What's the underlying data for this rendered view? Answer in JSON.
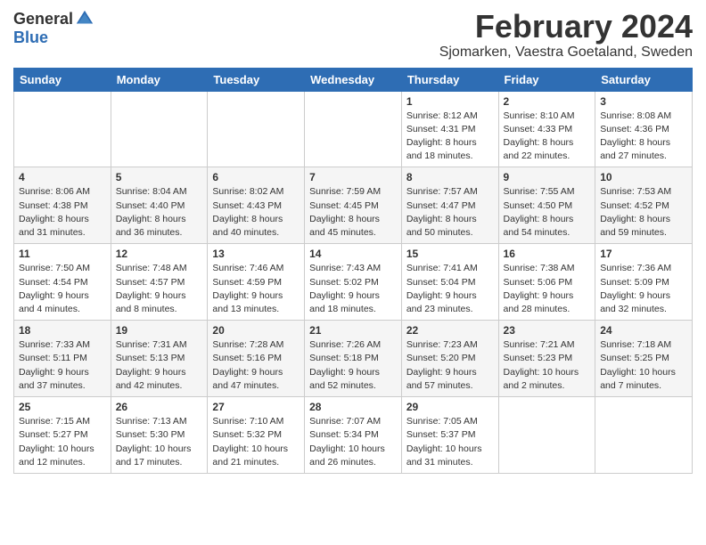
{
  "header": {
    "logo_general": "General",
    "logo_blue": "Blue",
    "month_title": "February 2024",
    "location": "Sjomarken, Vaestra Goetaland, Sweden"
  },
  "days_of_week": [
    "Sunday",
    "Monday",
    "Tuesday",
    "Wednesday",
    "Thursday",
    "Friday",
    "Saturday"
  ],
  "weeks": [
    [
      {
        "day": "",
        "info": ""
      },
      {
        "day": "",
        "info": ""
      },
      {
        "day": "",
        "info": ""
      },
      {
        "day": "",
        "info": ""
      },
      {
        "day": "1",
        "info": "Sunrise: 8:12 AM\nSunset: 4:31 PM\nDaylight: 8 hours\nand 18 minutes."
      },
      {
        "day": "2",
        "info": "Sunrise: 8:10 AM\nSunset: 4:33 PM\nDaylight: 8 hours\nand 22 minutes."
      },
      {
        "day": "3",
        "info": "Sunrise: 8:08 AM\nSunset: 4:36 PM\nDaylight: 8 hours\nand 27 minutes."
      }
    ],
    [
      {
        "day": "4",
        "info": "Sunrise: 8:06 AM\nSunset: 4:38 PM\nDaylight: 8 hours\nand 31 minutes."
      },
      {
        "day": "5",
        "info": "Sunrise: 8:04 AM\nSunset: 4:40 PM\nDaylight: 8 hours\nand 36 minutes."
      },
      {
        "day": "6",
        "info": "Sunrise: 8:02 AM\nSunset: 4:43 PM\nDaylight: 8 hours\nand 40 minutes."
      },
      {
        "day": "7",
        "info": "Sunrise: 7:59 AM\nSunset: 4:45 PM\nDaylight: 8 hours\nand 45 minutes."
      },
      {
        "day": "8",
        "info": "Sunrise: 7:57 AM\nSunset: 4:47 PM\nDaylight: 8 hours\nand 50 minutes."
      },
      {
        "day": "9",
        "info": "Sunrise: 7:55 AM\nSunset: 4:50 PM\nDaylight: 8 hours\nand 54 minutes."
      },
      {
        "day": "10",
        "info": "Sunrise: 7:53 AM\nSunset: 4:52 PM\nDaylight: 8 hours\nand 59 minutes."
      }
    ],
    [
      {
        "day": "11",
        "info": "Sunrise: 7:50 AM\nSunset: 4:54 PM\nDaylight: 9 hours\nand 4 minutes."
      },
      {
        "day": "12",
        "info": "Sunrise: 7:48 AM\nSunset: 4:57 PM\nDaylight: 9 hours\nand 8 minutes."
      },
      {
        "day": "13",
        "info": "Sunrise: 7:46 AM\nSunset: 4:59 PM\nDaylight: 9 hours\nand 13 minutes."
      },
      {
        "day": "14",
        "info": "Sunrise: 7:43 AM\nSunset: 5:02 PM\nDaylight: 9 hours\nand 18 minutes."
      },
      {
        "day": "15",
        "info": "Sunrise: 7:41 AM\nSunset: 5:04 PM\nDaylight: 9 hours\nand 23 minutes."
      },
      {
        "day": "16",
        "info": "Sunrise: 7:38 AM\nSunset: 5:06 PM\nDaylight: 9 hours\nand 28 minutes."
      },
      {
        "day": "17",
        "info": "Sunrise: 7:36 AM\nSunset: 5:09 PM\nDaylight: 9 hours\nand 32 minutes."
      }
    ],
    [
      {
        "day": "18",
        "info": "Sunrise: 7:33 AM\nSunset: 5:11 PM\nDaylight: 9 hours\nand 37 minutes."
      },
      {
        "day": "19",
        "info": "Sunrise: 7:31 AM\nSunset: 5:13 PM\nDaylight: 9 hours\nand 42 minutes."
      },
      {
        "day": "20",
        "info": "Sunrise: 7:28 AM\nSunset: 5:16 PM\nDaylight: 9 hours\nand 47 minutes."
      },
      {
        "day": "21",
        "info": "Sunrise: 7:26 AM\nSunset: 5:18 PM\nDaylight: 9 hours\nand 52 minutes."
      },
      {
        "day": "22",
        "info": "Sunrise: 7:23 AM\nSunset: 5:20 PM\nDaylight: 9 hours\nand 57 minutes."
      },
      {
        "day": "23",
        "info": "Sunrise: 7:21 AM\nSunset: 5:23 PM\nDaylight: 10 hours\nand 2 minutes."
      },
      {
        "day": "24",
        "info": "Sunrise: 7:18 AM\nSunset: 5:25 PM\nDaylight: 10 hours\nand 7 minutes."
      }
    ],
    [
      {
        "day": "25",
        "info": "Sunrise: 7:15 AM\nSunset: 5:27 PM\nDaylight: 10 hours\nand 12 minutes."
      },
      {
        "day": "26",
        "info": "Sunrise: 7:13 AM\nSunset: 5:30 PM\nDaylight: 10 hours\nand 17 minutes."
      },
      {
        "day": "27",
        "info": "Sunrise: 7:10 AM\nSunset: 5:32 PM\nDaylight: 10 hours\nand 21 minutes."
      },
      {
        "day": "28",
        "info": "Sunrise: 7:07 AM\nSunset: 5:34 PM\nDaylight: 10 hours\nand 26 minutes."
      },
      {
        "day": "29",
        "info": "Sunrise: 7:05 AM\nSunset: 5:37 PM\nDaylight: 10 hours\nand 31 minutes."
      },
      {
        "day": "",
        "info": ""
      },
      {
        "day": "",
        "info": ""
      }
    ]
  ]
}
